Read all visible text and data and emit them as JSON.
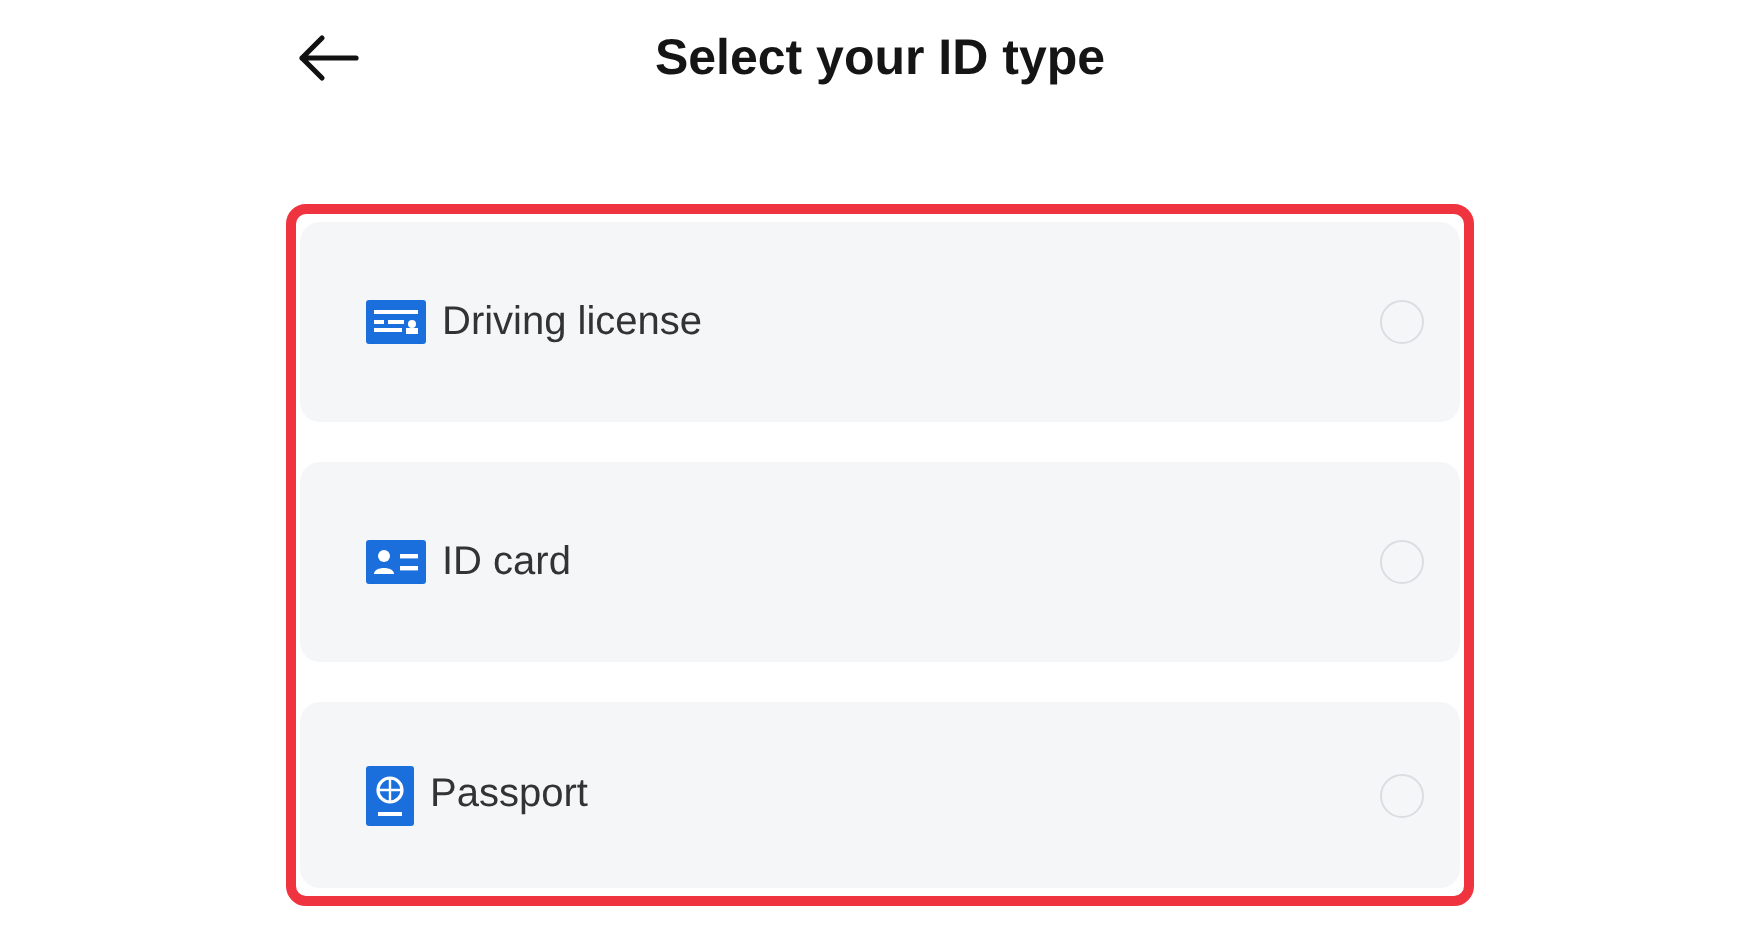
{
  "header": {
    "title": "Select your ID type"
  },
  "options": [
    {
      "kind": "license",
      "label": "Driving license",
      "selected": false
    },
    {
      "kind": "card",
      "label": "ID card",
      "selected": false
    },
    {
      "kind": "passport",
      "label": "Passport",
      "selected": false
    }
  ]
}
